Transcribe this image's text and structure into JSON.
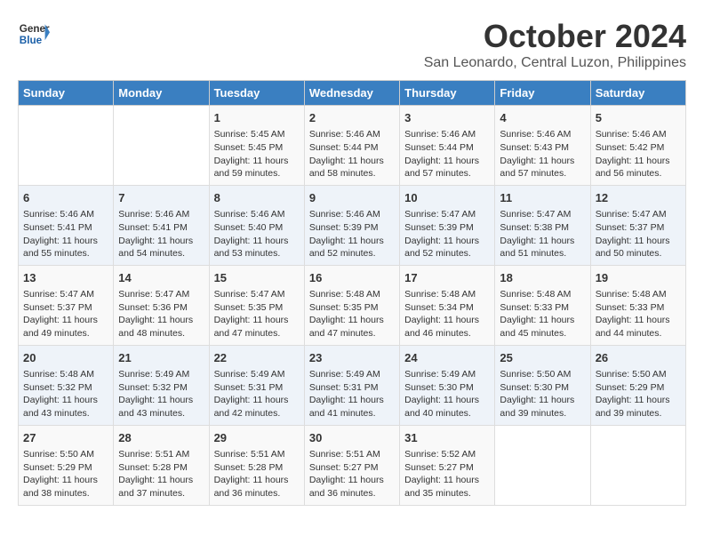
{
  "header": {
    "logo_line1": "General",
    "logo_line2": "Blue",
    "month": "October 2024",
    "location": "San Leonardo, Central Luzon, Philippines"
  },
  "days_of_week": [
    "Sunday",
    "Monday",
    "Tuesday",
    "Wednesday",
    "Thursday",
    "Friday",
    "Saturday"
  ],
  "weeks": [
    [
      {
        "day": "",
        "info": ""
      },
      {
        "day": "",
        "info": ""
      },
      {
        "day": "1",
        "info": "Sunrise: 5:45 AM\nSunset: 5:45 PM\nDaylight: 11 hours and 59 minutes."
      },
      {
        "day": "2",
        "info": "Sunrise: 5:46 AM\nSunset: 5:44 PM\nDaylight: 11 hours and 58 minutes."
      },
      {
        "day": "3",
        "info": "Sunrise: 5:46 AM\nSunset: 5:44 PM\nDaylight: 11 hours and 57 minutes."
      },
      {
        "day": "4",
        "info": "Sunrise: 5:46 AM\nSunset: 5:43 PM\nDaylight: 11 hours and 57 minutes."
      },
      {
        "day": "5",
        "info": "Sunrise: 5:46 AM\nSunset: 5:42 PM\nDaylight: 11 hours and 56 minutes."
      }
    ],
    [
      {
        "day": "6",
        "info": "Sunrise: 5:46 AM\nSunset: 5:41 PM\nDaylight: 11 hours and 55 minutes."
      },
      {
        "day": "7",
        "info": "Sunrise: 5:46 AM\nSunset: 5:41 PM\nDaylight: 11 hours and 54 minutes."
      },
      {
        "day": "8",
        "info": "Sunrise: 5:46 AM\nSunset: 5:40 PM\nDaylight: 11 hours and 53 minutes."
      },
      {
        "day": "9",
        "info": "Sunrise: 5:46 AM\nSunset: 5:39 PM\nDaylight: 11 hours and 52 minutes."
      },
      {
        "day": "10",
        "info": "Sunrise: 5:47 AM\nSunset: 5:39 PM\nDaylight: 11 hours and 52 minutes."
      },
      {
        "day": "11",
        "info": "Sunrise: 5:47 AM\nSunset: 5:38 PM\nDaylight: 11 hours and 51 minutes."
      },
      {
        "day": "12",
        "info": "Sunrise: 5:47 AM\nSunset: 5:37 PM\nDaylight: 11 hours and 50 minutes."
      }
    ],
    [
      {
        "day": "13",
        "info": "Sunrise: 5:47 AM\nSunset: 5:37 PM\nDaylight: 11 hours and 49 minutes."
      },
      {
        "day": "14",
        "info": "Sunrise: 5:47 AM\nSunset: 5:36 PM\nDaylight: 11 hours and 48 minutes."
      },
      {
        "day": "15",
        "info": "Sunrise: 5:47 AM\nSunset: 5:35 PM\nDaylight: 11 hours and 47 minutes."
      },
      {
        "day": "16",
        "info": "Sunrise: 5:48 AM\nSunset: 5:35 PM\nDaylight: 11 hours and 47 minutes."
      },
      {
        "day": "17",
        "info": "Sunrise: 5:48 AM\nSunset: 5:34 PM\nDaylight: 11 hours and 46 minutes."
      },
      {
        "day": "18",
        "info": "Sunrise: 5:48 AM\nSunset: 5:33 PM\nDaylight: 11 hours and 45 minutes."
      },
      {
        "day": "19",
        "info": "Sunrise: 5:48 AM\nSunset: 5:33 PM\nDaylight: 11 hours and 44 minutes."
      }
    ],
    [
      {
        "day": "20",
        "info": "Sunrise: 5:48 AM\nSunset: 5:32 PM\nDaylight: 11 hours and 43 minutes."
      },
      {
        "day": "21",
        "info": "Sunrise: 5:49 AM\nSunset: 5:32 PM\nDaylight: 11 hours and 43 minutes."
      },
      {
        "day": "22",
        "info": "Sunrise: 5:49 AM\nSunset: 5:31 PM\nDaylight: 11 hours and 42 minutes."
      },
      {
        "day": "23",
        "info": "Sunrise: 5:49 AM\nSunset: 5:31 PM\nDaylight: 11 hours and 41 minutes."
      },
      {
        "day": "24",
        "info": "Sunrise: 5:49 AM\nSunset: 5:30 PM\nDaylight: 11 hours and 40 minutes."
      },
      {
        "day": "25",
        "info": "Sunrise: 5:50 AM\nSunset: 5:30 PM\nDaylight: 11 hours and 39 minutes."
      },
      {
        "day": "26",
        "info": "Sunrise: 5:50 AM\nSunset: 5:29 PM\nDaylight: 11 hours and 39 minutes."
      }
    ],
    [
      {
        "day": "27",
        "info": "Sunrise: 5:50 AM\nSunset: 5:29 PM\nDaylight: 11 hours and 38 minutes."
      },
      {
        "day": "28",
        "info": "Sunrise: 5:51 AM\nSunset: 5:28 PM\nDaylight: 11 hours and 37 minutes."
      },
      {
        "day": "29",
        "info": "Sunrise: 5:51 AM\nSunset: 5:28 PM\nDaylight: 11 hours and 36 minutes."
      },
      {
        "day": "30",
        "info": "Sunrise: 5:51 AM\nSunset: 5:27 PM\nDaylight: 11 hours and 36 minutes."
      },
      {
        "day": "31",
        "info": "Sunrise: 5:52 AM\nSunset: 5:27 PM\nDaylight: 11 hours and 35 minutes."
      },
      {
        "day": "",
        "info": ""
      },
      {
        "day": "",
        "info": ""
      }
    ]
  ]
}
